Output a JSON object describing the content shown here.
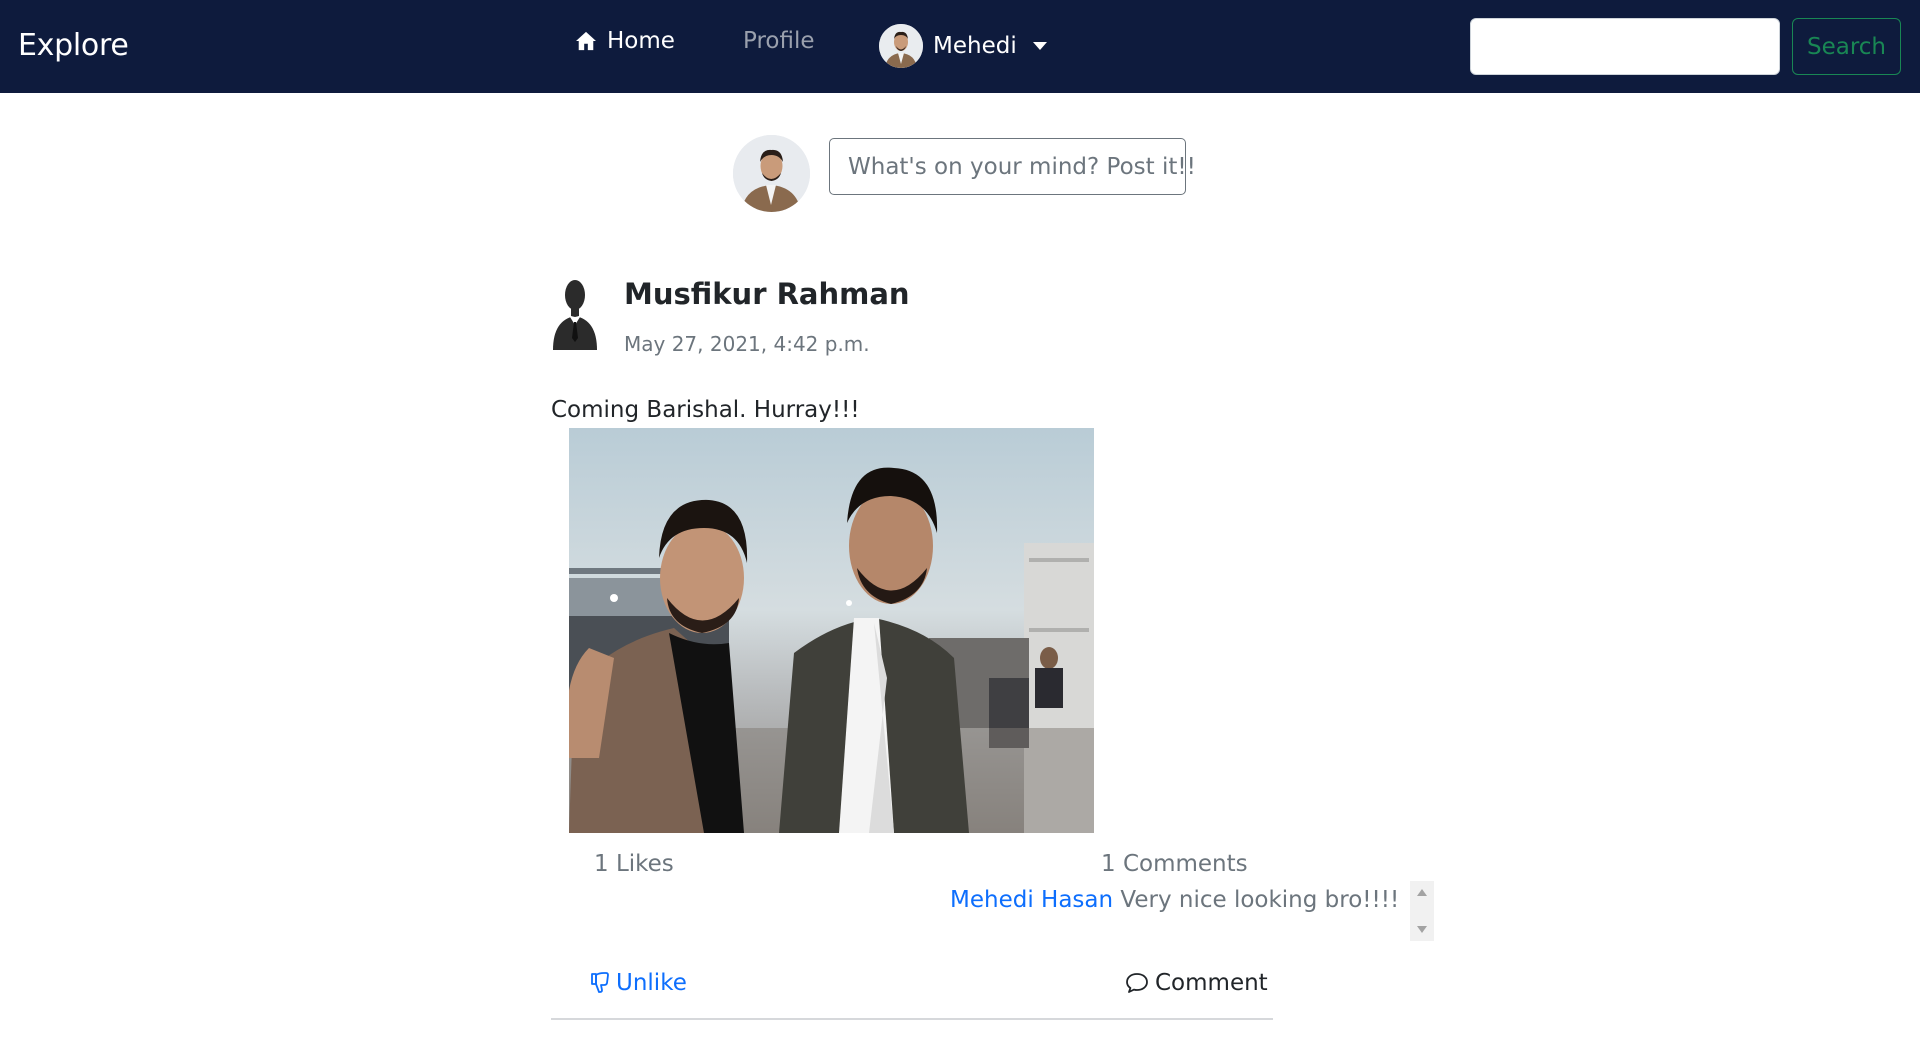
{
  "navbar": {
    "brand": "Explore",
    "home_label": "Home",
    "profile_label": "Profile",
    "user_name": "Mehedi",
    "search_placeholder": "",
    "search_button": "Search"
  },
  "composer": {
    "placeholder": "What's on your mind? Post it!!"
  },
  "post": {
    "author": "Musfikur Rahman",
    "timestamp": "May 27, 2021, 4:42 p.m.",
    "text": "Coming Barishal. Hurray!!!",
    "likes": "1 Likes",
    "comments_count": "1 Comments",
    "comments": [
      {
        "author": "Mehedi Hasan",
        "text": "Very nice looking bro!!!!"
      }
    ],
    "unlike_label": "Unlike",
    "comment_label": "Comment"
  },
  "icons": {
    "home": "home-icon",
    "caret": "caret-down-icon",
    "unlike": "thumbs-down-icon",
    "comment": "chat-bubble-icon"
  },
  "colors": {
    "navbar_bg": "#0e1b3d",
    "link_blue": "#0d6efd",
    "search_green": "#198754",
    "muted": "#6c757d"
  }
}
